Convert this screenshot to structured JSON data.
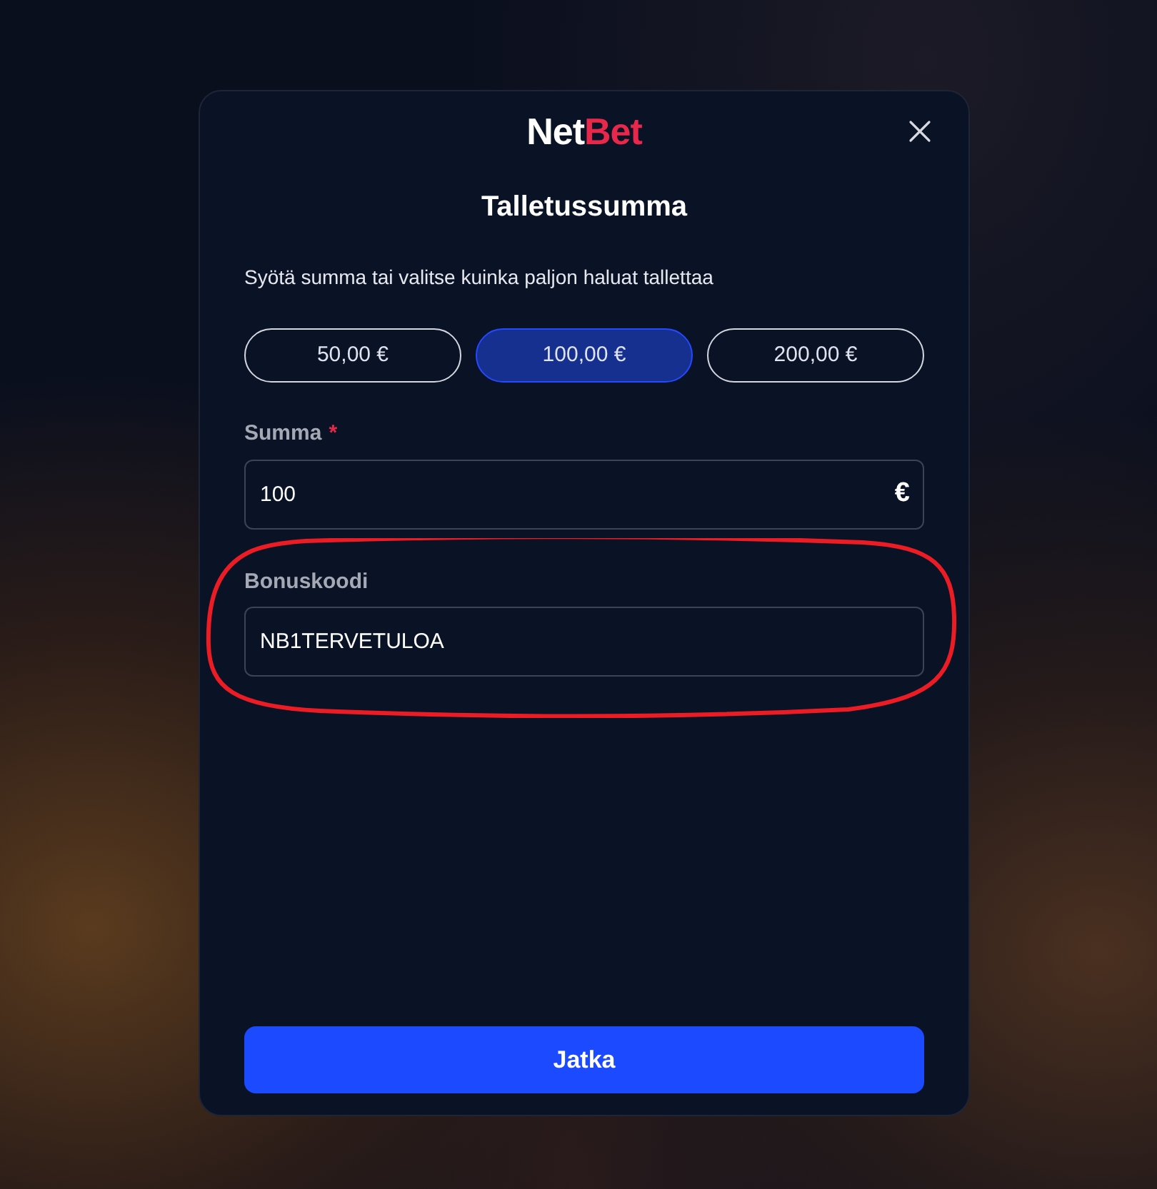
{
  "logo": [
    {
      "text": "Net",
      "color": "#ffffff"
    },
    {
      "text": "Bet",
      "color": "#e8284a"
    }
  ],
  "title": "Talletussumma",
  "subtitle": "Syötä summa tai valitse kuinka paljon haluat tallettaa",
  "presets": [
    {
      "label": "50,00 €",
      "selected": false
    },
    {
      "label": "100,00 €",
      "selected": true
    },
    {
      "label": "200,00 €",
      "selected": false
    }
  ],
  "amount": {
    "label": "Summa",
    "required_mark": "*",
    "value": "100",
    "currency": "€"
  },
  "bonus_code": {
    "label": "Bonuskoodi",
    "value": "NB1TERVETULOA",
    "circled": true
  },
  "continue_button": "Jatka"
}
